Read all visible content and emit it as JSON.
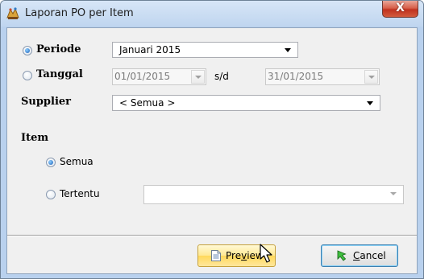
{
  "window": {
    "title": "Laporan PO per Item",
    "close_glyph": "X"
  },
  "periode": {
    "label": "Periode",
    "selected": true,
    "value": "Januari 2015"
  },
  "tanggal": {
    "label": "Tanggal",
    "selected": false,
    "from": "01/01/2015",
    "separator": "s/d",
    "to": "31/01/2015"
  },
  "supplier": {
    "label": "Supplier",
    "value": "< Semua >"
  },
  "item": {
    "label": "Item",
    "semua_label": "Semua",
    "semua_selected": true,
    "tertentu_label": "Tertentu",
    "tertentu_selected": false,
    "tertentu_value": ""
  },
  "buttons": {
    "preview": {
      "label_pre": "Pre",
      "label_mnemonic": "v",
      "label_post": "iew",
      "icon": "document-icon"
    },
    "cancel": {
      "label_mnemonic": "C",
      "label_post": "ancel",
      "icon": "green-arrow-icon"
    }
  },
  "colors": {
    "title_bar": "#c7dcf3",
    "client_bg": "#f0f0f0",
    "close_button": "#c0321f",
    "radio_dot": "#1b5fb8",
    "preview_hover": "#ffe891"
  }
}
